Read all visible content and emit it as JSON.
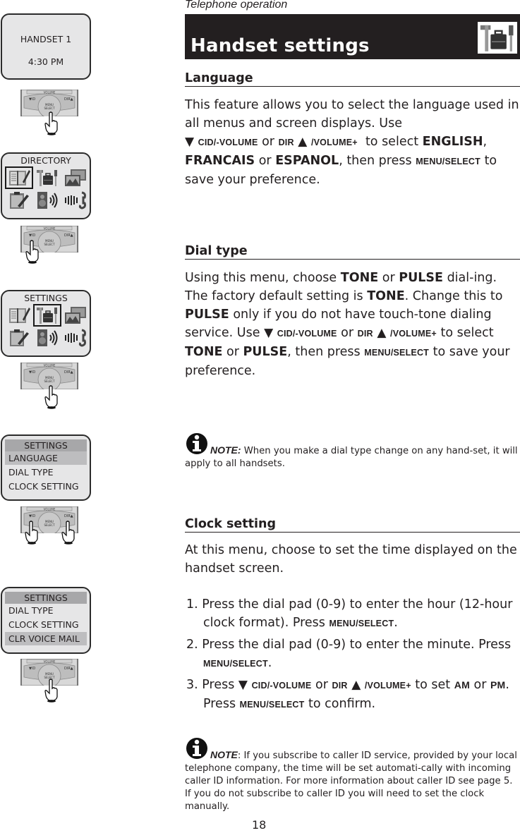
{
  "running_head": "Telephone operation",
  "banner": {
    "title": "Handset settings",
    "icon": "tools-briefcase-icon"
  },
  "keys": {
    "down_arrow": "▼",
    "up_arrow": "▲",
    "cid_volume": "CID/-VOLUME",
    "dir": "DIR",
    "volume_plus": "/VOLUME+",
    "menu_select": "MENU/SELECT"
  },
  "sections": {
    "language": {
      "heading": "Language",
      "text_1": "This feature allows you to select the language used in all menus and screen displays. Use",
      "or": "or",
      "text_2": "to select",
      "opt_1": "ENGLISH",
      "comma": ",",
      "opt_2": "FRANCAIS",
      "or_2": "or",
      "opt_3": "ESPANOL",
      "text_3": ", then press",
      "text_4": "to save your preference."
    },
    "dial_type": {
      "heading": "Dial type",
      "t1": "Using this menu, choose",
      "tone": "TONE",
      "or": "or",
      "pulse": "PULSE",
      "t2": "dial-ing.  The factory default setting is",
      "t3": ". Change this to",
      "t4": "only if you do not have touch-tone dialing service. Use",
      "t5": "to select",
      "t6": ", then press",
      "t7": "to save your preference."
    },
    "dial_note": {
      "label": "NOTE:",
      "text": "When you make a dial type change on any hand-set, it will apply to all handsets."
    },
    "clock": {
      "heading": "Clock setting",
      "intro": "At this menu, choose to set the time displayed on the handset screen.",
      "steps": [
        {
          "num": "1.",
          "text": "Press the dial pad (0-9) to enter the hour (12-hour clock format). Press"
        },
        {
          "num": "2.",
          "text": "Press the dial pad (0-9) to enter the minute. Press"
        },
        {
          "num": "3.",
          "text_a": "Press",
          "text_b": "to set",
          "am": "AM",
          "or": "or",
          "pm": "PM",
          "text_c": ". Press",
          "text_d": "to confirm."
        }
      ]
    },
    "clock_note": {
      "label": "NOTE",
      "text": ": If you subscribe to caller ID service, provided by your local telephone company, the time will be set automati-cally with incoming caller ID information. For more information about caller ID see page 5. If you do not subscribe to caller ID you will need to set the clock manually."
    }
  },
  "screens": [
    {
      "line_1": "HANDSET 1",
      "line_2": "4:30 PM",
      "press": "MENU/SELECT"
    },
    {
      "title": "DIRECTORY",
      "icons": [
        "directory-book-icon",
        "tools-briefcase-icon",
        "pictures-icon",
        "notepad-icon",
        "speaker-icon",
        "ringer-phone-icon"
      ],
      "selected_index": 0,
      "press": "CID/-VOLUME"
    },
    {
      "title": "SETTINGS",
      "icons": [
        "directory-book-icon",
        "tools-briefcase-icon",
        "pictures-icon",
        "notepad-icon",
        "speaker-icon",
        "ringer-phone-icon"
      ],
      "selected_index": 1,
      "press": "MENU/SELECT"
    },
    {
      "title": "SETTINGS",
      "items": [
        "LANGUAGE",
        "DIAL TYPE",
        "CLOCK SETTING"
      ],
      "selected_index": 0,
      "press": "CID/-VOLUME and DIR/VOLUME+"
    },
    {
      "title": "SETTINGS",
      "items": [
        "DIAL TYPE",
        "CLOCK SETTING",
        "CLR VOICE MAIL"
      ],
      "selected_index": 2,
      "press": "MENU/SELECT"
    }
  ],
  "page_number": "18"
}
